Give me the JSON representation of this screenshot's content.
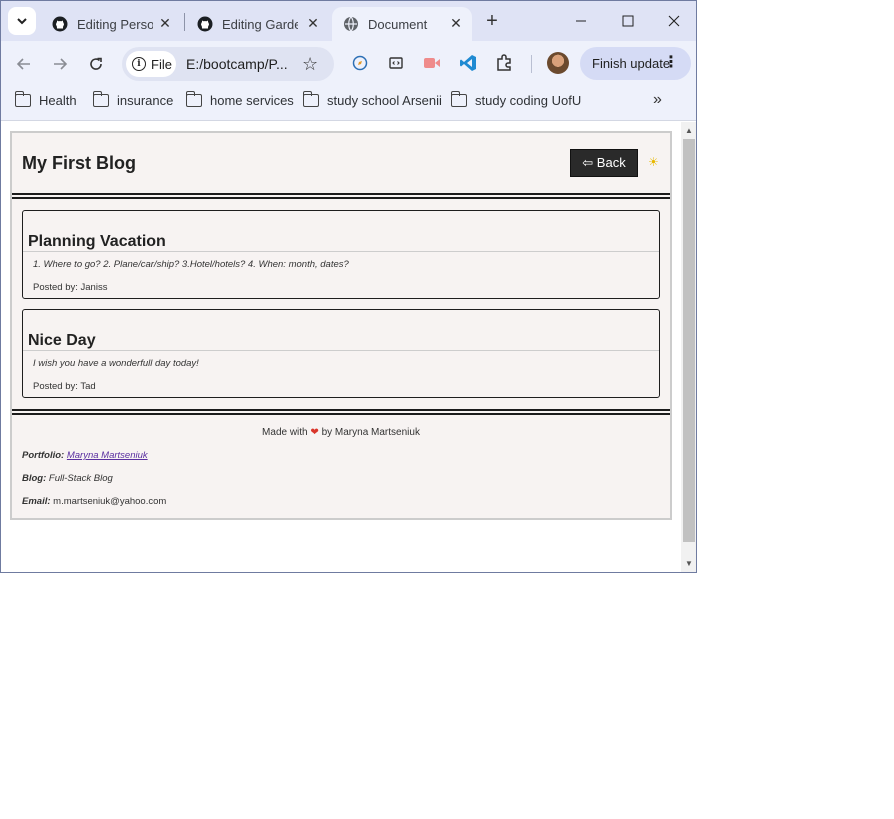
{
  "browser": {
    "tabs": [
      {
        "title": "Editing Person",
        "icon": "github-icon"
      },
      {
        "title": "Editing Garde",
        "icon": "github-icon"
      },
      {
        "title": "Document",
        "icon": "globe-icon"
      }
    ],
    "omnibox": {
      "chip_label": "File",
      "url": "E:/bootcamp/P..."
    },
    "finish_update_label": "Finish update",
    "bookmarks": [
      "Health",
      "insurance",
      "home services",
      "study school Arsenii",
      "study coding UofU"
    ]
  },
  "page": {
    "title": "My First Blog",
    "back_label": "⇦ Back",
    "mode_icon": "sun-icon",
    "posts": [
      {
        "title": "Planning Vacation",
        "body": "1. Where to go? 2. Plane/car/ship? 3.Hotel/hotels? 4. When: month, dates?",
        "by": "Posted by: Janiss"
      },
      {
        "title": "Nice Day",
        "body": "I wish you have a wonderfull day today!",
        "by": "Posted by: Tad"
      }
    ],
    "footer": {
      "made_prefix": "Made with",
      "made_suffix": "by Maryna Martseniuk",
      "portfolio_label": "Portfolio:",
      "portfolio_value": "Maryna Martseniuk",
      "blog_label": "Blog:",
      "blog_value": "Full-Stack Blog",
      "email_label": "Email:",
      "email_value": "m.martseniuk@yahoo.com"
    }
  },
  "colors": {
    "accent_tab": "#dfe3f5",
    "toolbar": "#eef1fb",
    "page_bg": "#f7f3f2",
    "heart": "#d9352b"
  }
}
